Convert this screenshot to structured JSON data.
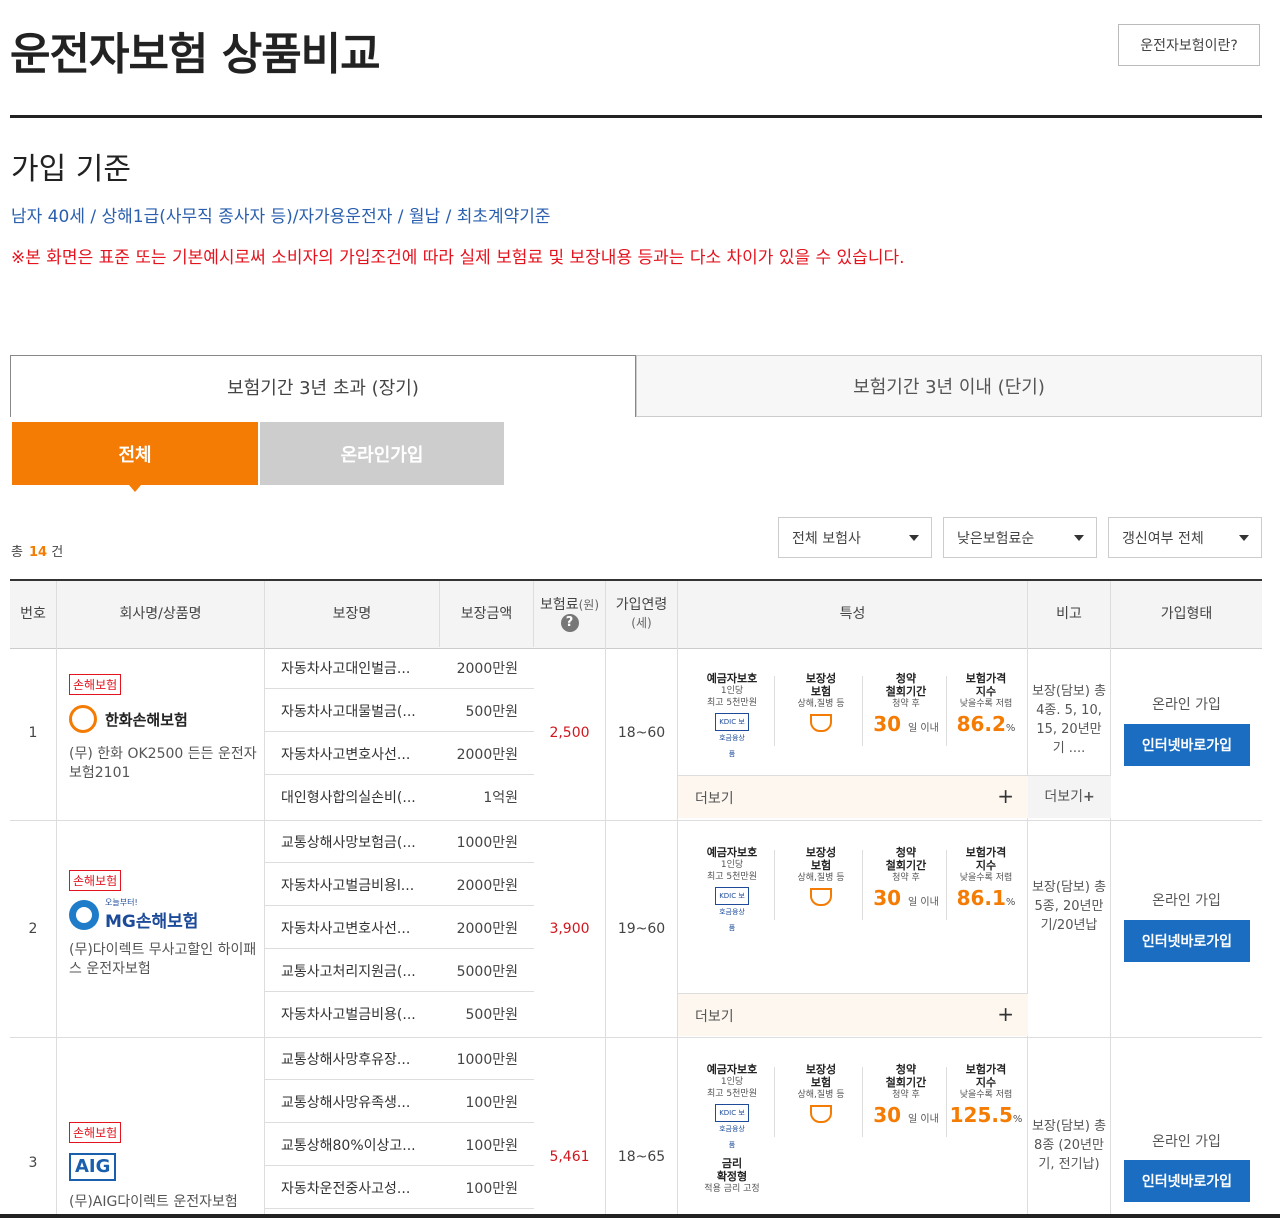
{
  "header": {
    "title": "운전자보험 상품비교",
    "about_button": "운전자보험이란?"
  },
  "criteria": {
    "title": "가입 기준",
    "conditions": "남자 40세 / 상해1급(사무직 종사자 등)/자가용운전자 / 월납 / 최초계약기준",
    "notice": "※본 화면은 표준 또는 기본예시로써 소비자의 가입조건에 따라 실제 보험료 및 보장내용 등과는 다소 차이가 있을 수 있습니다."
  },
  "tabs": [
    {
      "label": "보험기간 3년 초과 (장기)",
      "active": true
    },
    {
      "label": "보험기간 3년 이내 (단기)",
      "active": false
    }
  ],
  "subtabs": [
    {
      "label": "전체",
      "active": true
    },
    {
      "label": "온라인가입",
      "active": false
    }
  ],
  "summary": {
    "prefix": "총",
    "count": "14",
    "suffix": "건"
  },
  "filters": [
    {
      "selected": "전체 보험사"
    },
    {
      "selected": "낮은보험료순"
    },
    {
      "selected": "갱신여부 전체"
    }
  ],
  "table": {
    "headers": {
      "no": "번호",
      "company": "회사명/상품명",
      "coverage_name": "보장명",
      "coverage_amount": "보장금액",
      "premium": "보험료",
      "premium_unit": "(원)",
      "premium_help": "?",
      "age": "가입연령",
      "age_unit": "(세)",
      "features": "특성",
      "note": "비고",
      "join_type": "가입형태"
    },
    "feature_labels": {
      "kdic_title": "예금자보호",
      "kdic_sub1": "1인당",
      "kdic_sub2": "최고 5천만원",
      "kdic_mark": "KDIC 보호금융상품",
      "guarantee_title1": "보장성",
      "guarantee_title2": "보험",
      "guarantee_sub": "상해,질병 등",
      "withdraw_title1": "청약",
      "withdraw_title2": "철회기간",
      "withdraw_sub": "청약 후",
      "withdraw_value": "30",
      "withdraw_unit": "일 이내",
      "price_title1": "보험가격",
      "price_title2": "지수",
      "price_sub": "낮을수록 저렴",
      "price_unit": "%",
      "fixed_title1": "금리",
      "fixed_title2": "확정형",
      "fixed_sub": "적용 금리 고정"
    },
    "more_label": "더보기",
    "more_plus": "+",
    "rows": [
      {
        "no": "1",
        "badge": "손해보험",
        "company": "한화손해보험",
        "product": "(무) 한화 OK2500 든든 운전자보험2101",
        "coverages": [
          {
            "name": "자동차사고대인벌금...",
            "amount": "2000만원"
          },
          {
            "name": "자동차사고대물벌금(...",
            "amount": "500만원"
          },
          {
            "name": "자동차사고변호사선...",
            "amount": "2000만원"
          },
          {
            "name": "대인형사합의실손비(...",
            "amount": "1억원"
          }
        ],
        "premium": "2,500",
        "ages": "18~60",
        "price_index": "86.2",
        "note": "보장(담보) 총 4종. 5, 10, 15, 20년만기 ....",
        "note_more": "더보기",
        "join_label": "온라인 가입",
        "join_button": "인터넷바로가입"
      },
      {
        "no": "2",
        "badge": "손해보험",
        "company": "MG손해보험",
        "company_tag": "오늘부터!",
        "product": "(무)다이렉트 무사고할인 하이패스 운전자보험",
        "coverages": [
          {
            "name": "교통상해사망보험금(...",
            "amount": "1000만원"
          },
          {
            "name": "자동차사고벌금비용l...",
            "amount": "2000만원"
          },
          {
            "name": "자동차사고변호사선...",
            "amount": "2000만원"
          },
          {
            "name": "교통사고처리지원금(...",
            "amount": "5000만원"
          },
          {
            "name": "자동차사고벌금비용(...",
            "amount": "500만원"
          }
        ],
        "premium": "3,900",
        "ages": "19~60",
        "price_index": "86.1",
        "note": "보장(담보) 총 5종, 20년만기/20년납",
        "join_label": "온라인 가입",
        "join_button": "인터넷바로가입"
      },
      {
        "no": "3",
        "badge": "손해보험",
        "company": "AIG",
        "product": "(무)AIG다이렉트 운전자보험",
        "coverages": [
          {
            "name": "교통상해사망후유장...",
            "amount": "1000만원"
          },
          {
            "name": "교통상해사망유족생...",
            "amount": "100만원"
          },
          {
            "name": "교통상해80%이상고...",
            "amount": "100만원"
          },
          {
            "name": "자동차운전중사고성...",
            "amount": "100만원"
          }
        ],
        "premium": "5,461",
        "ages": "18~65",
        "price_index": "125.5",
        "note": "보장(담보) 총 8종 (20년만기, 전기납)",
        "join_label": "온라인 가입",
        "join_button": "인터넷바로가입"
      }
    ]
  }
}
